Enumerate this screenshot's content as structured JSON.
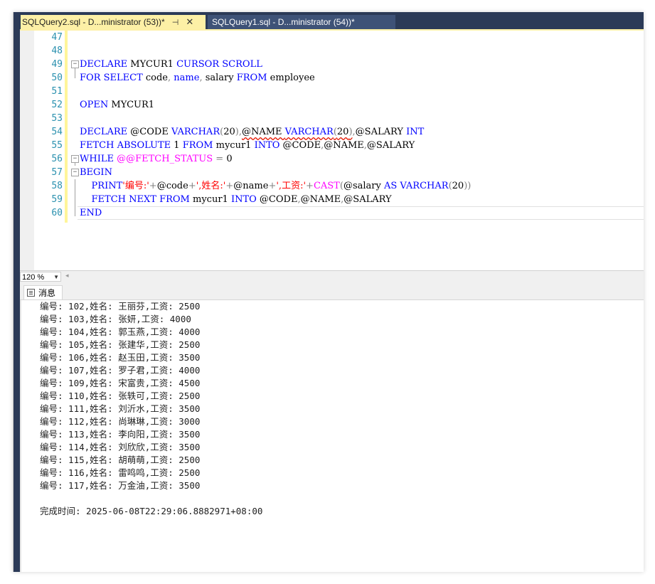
{
  "tabs": [
    {
      "label": "SQLQuery2.sql - D...ministrator (53))*",
      "active": true,
      "pin_icon": "pin-icon",
      "close_icon": "close-icon"
    },
    {
      "label": "SQLQuery1.sql - D...ministrator (54))*",
      "active": false
    }
  ],
  "editor": {
    "line_numbers": [
      "47",
      "48",
      "49",
      "50",
      "51",
      "52",
      "53",
      "54",
      "55",
      "56",
      "57",
      "58",
      "59",
      "60"
    ]
  },
  "zoom": {
    "value": "120 %"
  },
  "results": {
    "tab_label": "消息",
    "messages": [
      "编号: 102,姓名: 王丽芬,工资: 2500",
      "编号: 103,姓名: 张妍,工资: 4000",
      "编号: 104,姓名: 郭玉燕,工资: 4000",
      "编号: 105,姓名: 张建华,工资: 2500",
      "编号: 106,姓名: 赵玉田,工资: 3500",
      "编号: 107,姓名: 罗子君,工资: 4000",
      "编号: 109,姓名: 宋富贵,工资: 4500",
      "编号: 110,姓名: 张轶可,工资: 2500",
      "编号: 111,姓名: 刘沂水,工资: 3500",
      "编号: 112,姓名: 尚琳琳,工资: 3000",
      "编号: 113,姓名: 李向阳,工资: 3500",
      "编号: 114,姓名: 刘欣欣,工资: 3500",
      "编号: 115,姓名: 胡萌萌,工资: 2500",
      "编号: 116,姓名: 雷鸣鸣,工资: 2500",
      "编号: 117,姓名: 万金油,工资: 3500"
    ],
    "completion": "完成时间: 2025-06-08T22:29:06.8882971+08:00"
  },
  "code": {
    "l49": [
      "DECLARE",
      " MYCUR1 ",
      "CURSOR",
      " ",
      "SCROLL"
    ],
    "l50": [
      "FOR",
      " ",
      "SELECT",
      " code",
      ",",
      " ",
      "name",
      ",",
      " salary ",
      "FROM",
      " employee"
    ],
    "l52": [
      "OPEN",
      " MYCUR1"
    ],
    "l54": [
      "DECLARE",
      " @CODE ",
      "VARCHAR",
      "(",
      "20",
      ")",
      ",",
      "@NAME ",
      "VARCHAR",
      "(",
      "20",
      ")",
      ",",
      "@SALARY ",
      "INT"
    ],
    "l55": [
      "FETCH",
      " ",
      "ABSOLUTE",
      " 1 ",
      "FROM",
      " mycur1 ",
      "INTO",
      " @CODE",
      ",",
      "@NAME",
      ",",
      "@SALARY"
    ],
    "l56": [
      "WHILE",
      " ",
      "@@FETCH_STATUS",
      " ",
      "=",
      " 0"
    ],
    "l57": [
      "BEGIN"
    ],
    "l58": [
      "    ",
      "PRINT",
      "'编号:'",
      "+",
      "@code",
      "+",
      "',姓名:'",
      "+",
      "@name",
      "+",
      "',工资:'",
      "+",
      "CAST",
      "(",
      "@salary ",
      "AS",
      " ",
      "VARCHAR",
      "(",
      "20",
      "))"
    ],
    "l59": [
      "    ",
      "FETCH",
      " ",
      "NEXT",
      " ",
      "FROM",
      " mycur1 ",
      "INTO",
      " @CODE",
      ",",
      "@NAME",
      ",",
      "@SALARY"
    ],
    "l60": [
      "END"
    ]
  }
}
